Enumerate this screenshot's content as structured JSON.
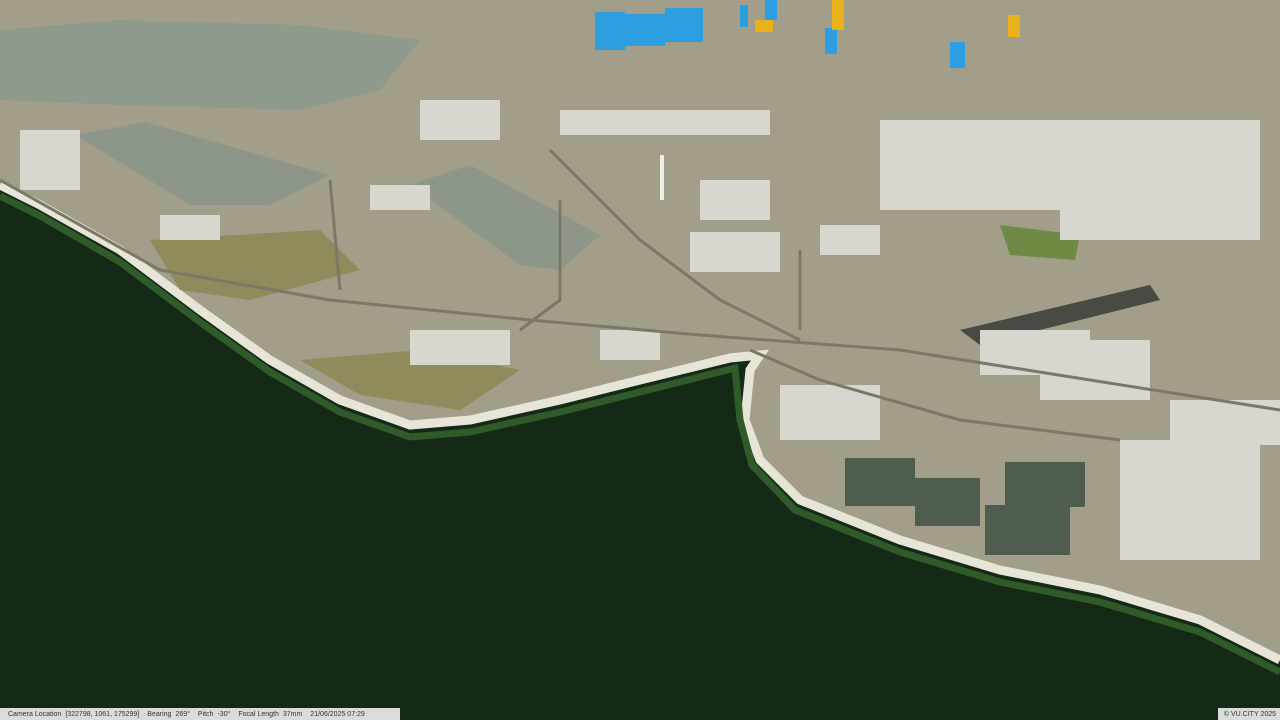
{
  "viewport": {
    "description_icon": "3d-map-icon",
    "colors": {
      "sea": "#152a16",
      "land": "#a39e8a",
      "shore": "#e7e4d8",
      "grass": "#8f8b5a",
      "water_inland": "#8e9a8c",
      "building": "#d9d6cf",
      "highlight_blue": "#2d9ee0",
      "highlight_yellow": "#e9b21a"
    }
  },
  "status": {
    "camera_label": "Camera Location",
    "camera_value": "[322798, 1061, 175299]",
    "bearing_label": "Bearing",
    "bearing_value": "269°",
    "pitch_label": "Pitch",
    "pitch_value": "-30°",
    "focal_label": "Focal Length",
    "focal_value": "37mm",
    "timestamp": "21/06/2025 07:29"
  },
  "copyright": "© VU.CITY 2025"
}
